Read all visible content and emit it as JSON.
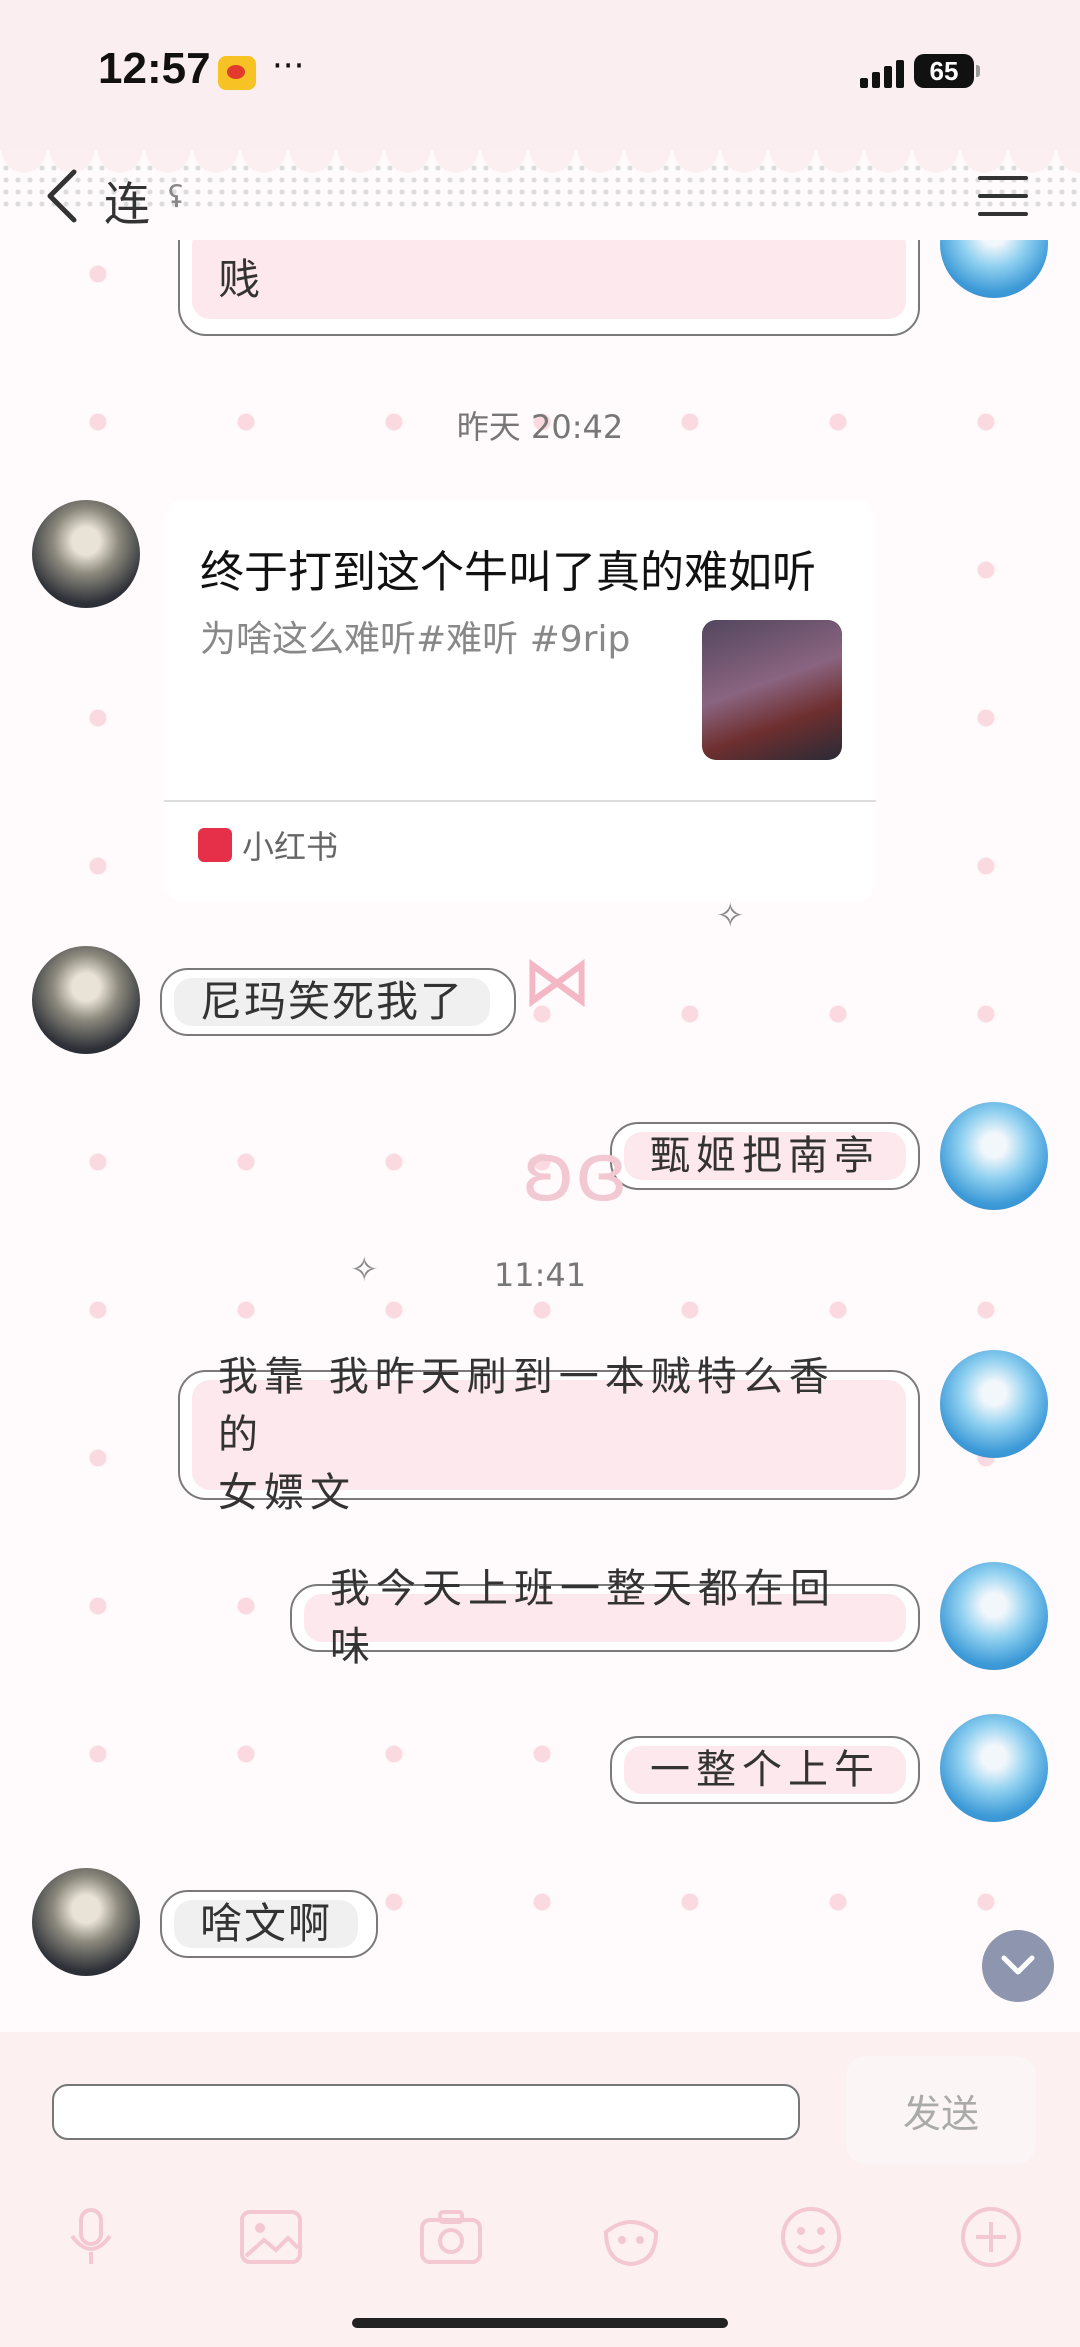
{
  "status_bar": {
    "time": "12:57",
    "app_icon": "weibo-icon",
    "more": "···",
    "battery": "65"
  },
  "header": {
    "contact_name": "连",
    "back_icon": "chevron-left-icon",
    "menu_icon": "hamburger-menu-icon"
  },
  "messages": {
    "m0": {
      "text": "贱",
      "side": "right"
    },
    "time1": "昨天 20:42",
    "card": {
      "title": "终于打到这个牛叫了真的难如听",
      "desc": "为啥这么难听#难听  #9rip",
      "source": "小红书"
    },
    "m1": {
      "text": "尼玛笑死我了",
      "side": "left"
    },
    "m2": {
      "text": "甄姬把南亭",
      "side": "right"
    },
    "time2": "11:41",
    "m3": {
      "line1": "我靠 我昨天刷到一本贼特么香的",
      "line2": "女嫖文",
      "side": "right"
    },
    "m4": {
      "text": "我今天上班一整天都在回味",
      "side": "right"
    },
    "m5": {
      "text": "一整个上午",
      "side": "right"
    },
    "m6": {
      "text": "啥文啊",
      "side": "left"
    }
  },
  "input": {
    "placeholder": "",
    "send_label": "发送"
  },
  "toolbar": [
    "microphone-icon",
    "image-icon",
    "camera-icon",
    "sticker-icon",
    "emoji-icon",
    "plus-icon"
  ],
  "colors": {
    "bubble_fill": "#fde8ee",
    "bubble_border": "#7a7a7a",
    "status_bg": "#fbeef0",
    "dot": "#fbd9e1",
    "scroll_button": "#8e95ae"
  }
}
